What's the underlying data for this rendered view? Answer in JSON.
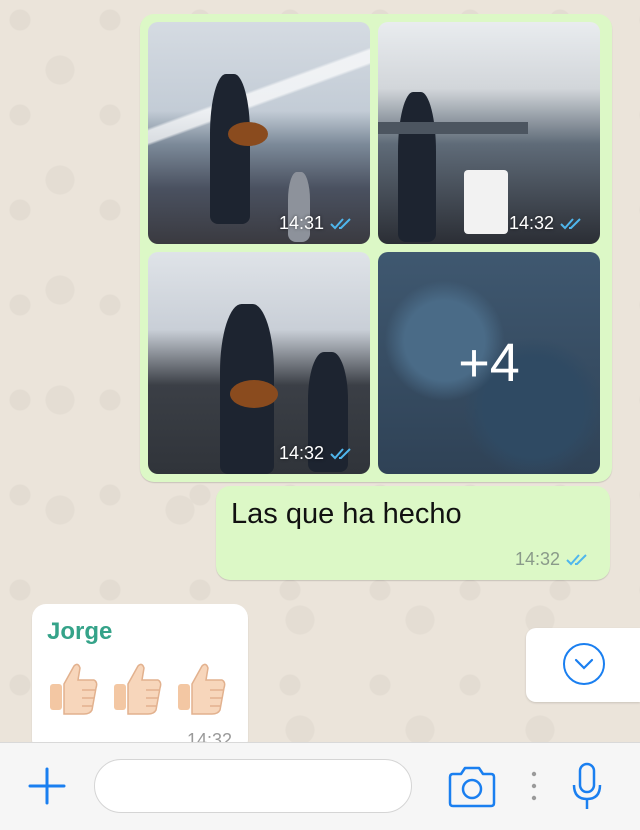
{
  "media_group": {
    "tiles": [
      {
        "time": "14:31"
      },
      {
        "time": "14:32"
      },
      {
        "time": "14:32"
      },
      {
        "more": "+4"
      }
    ]
  },
  "outgoing_message": {
    "text": "Las que ha hecho",
    "time": "14:32"
  },
  "incoming_message": {
    "sender": "Jorge",
    "emoji": [
      "thumbs-up",
      "thumbs-up",
      "thumbs-up"
    ],
    "time": "14:32"
  },
  "colors": {
    "outgoing_bubble": "#dcf8c6",
    "incoming_bubble": "#ffffff",
    "sender_name": "#35a389",
    "accent_blue": "#1a7ff0",
    "read_ticks": "#4fb6ec"
  },
  "icons": {
    "plus": "plus-icon",
    "camera": "camera-icon",
    "mic": "microphone-icon",
    "scroll_down": "chevron-down-icon",
    "dots": "more-vertical-icon"
  },
  "composer": {
    "placeholder": ""
  }
}
